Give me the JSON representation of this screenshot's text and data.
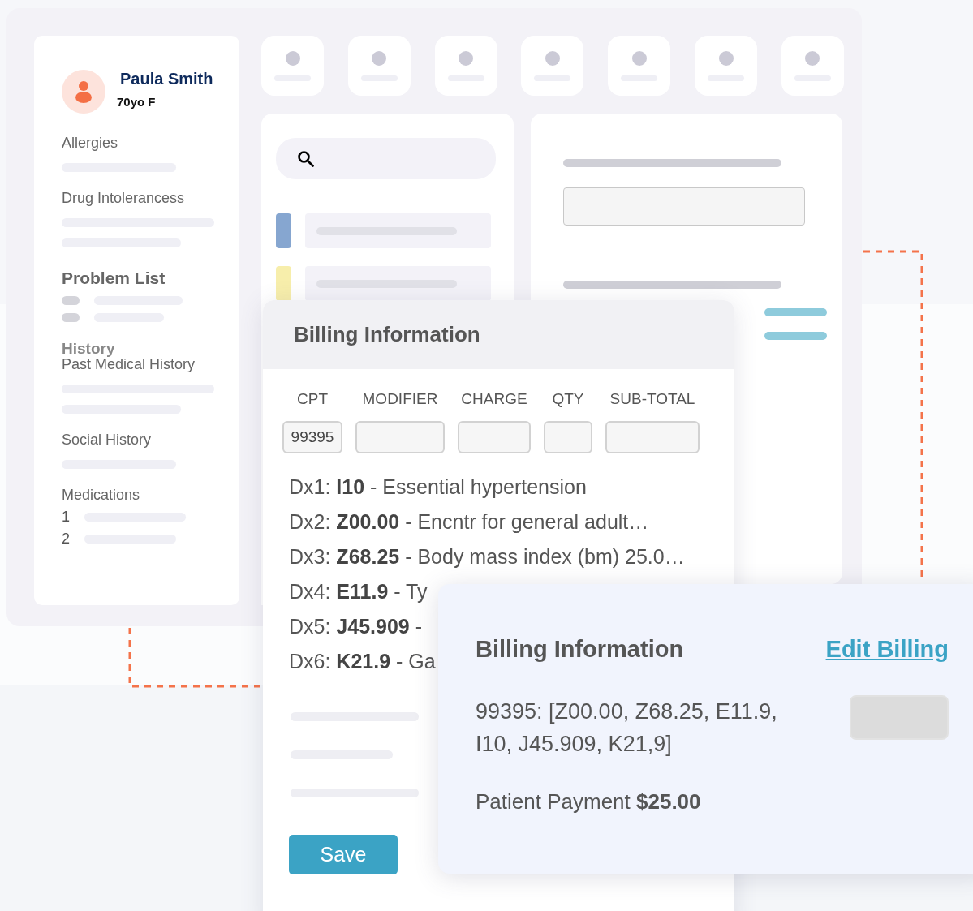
{
  "patient": {
    "name": "Paula Smith",
    "age_sex": "70yo F"
  },
  "sidebar": {
    "sections": [
      {
        "kind": "plain",
        "label": "Allergies"
      },
      {
        "kind": "plain",
        "label": "Drug Intolerancess"
      },
      {
        "kind": "problems",
        "label": "Problem List"
      },
      {
        "kind": "heading",
        "label": "History"
      },
      {
        "kind": "plain",
        "label": "Past Medical History"
      },
      {
        "kind": "plain",
        "label": "Social History"
      },
      {
        "kind": "numbered",
        "label": "Medications",
        "items": [
          "1",
          "2"
        ]
      }
    ]
  },
  "list_items": [
    {
      "color": "#86a6d0"
    },
    {
      "color": "#f7eeab"
    }
  ],
  "billing_form": {
    "title": "Billing Information",
    "columns": [
      {
        "header": "CPT",
        "value": "99395"
      },
      {
        "header": "MODIFIER"
      },
      {
        "header": "CHARGE"
      },
      {
        "header": "QTY"
      },
      {
        "header": "SUB-TOTAL"
      }
    ],
    "diagnoses": [
      "Dx1: **I10** - Essential hypertension",
      "Dx2: **Z00.00** - Encntr for general adult…",
      "Dx3: **Z68.25** - Body mass index (bm) 25.0…",
      "Dx4: **E11.9** - Ty",
      "Dx5: **J45.909** -",
      "Dx6: **K21.9** - Ga"
    ],
    "save_button": "Save"
  },
  "billing_summary": {
    "title": "Billing Information",
    "edit_link": "Edit Billing",
    "codes": "99395: [Z00.00, Z68.25, E11.9, I10, J45.909, K21,9]",
    "payment": "Patient Payment **$25.00**"
  }
}
